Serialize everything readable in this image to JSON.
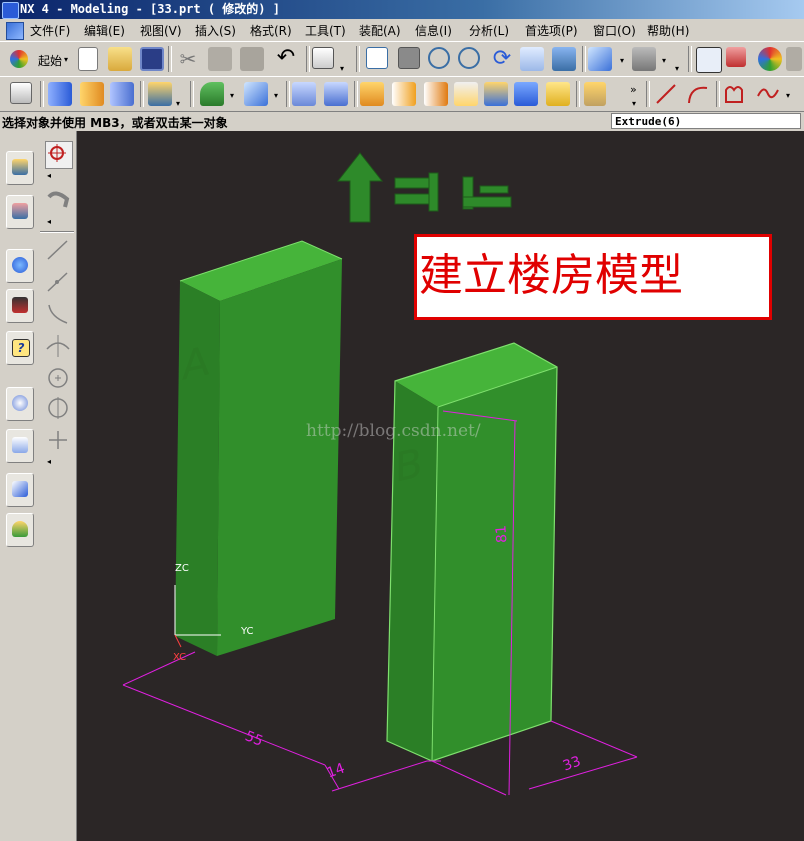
{
  "window": {
    "title": "NX 4 - Modeling - [33.prt ( 修改的) ]"
  },
  "menu": [
    {
      "label": "文件(F)"
    },
    {
      "label": "编辑(E)"
    },
    {
      "label": "视图(V)"
    },
    {
      "label": "插入(S)"
    },
    {
      "label": "格式(R)"
    },
    {
      "label": "工具(T)"
    },
    {
      "label": "装配(A)"
    },
    {
      "label": "信息(I)"
    },
    {
      "label": "分析(L)"
    },
    {
      "label": "首选项(P)"
    },
    {
      "label": "窗口(O)"
    },
    {
      "label": "帮助(H)"
    }
  ],
  "toolbar": {
    "start_label": "起始"
  },
  "status": {
    "prompt": "选择对象并使用 MB3，或者双击某一对象",
    "operation": "Extrude(6)"
  },
  "viewport": {
    "caption": "建立楼房模型",
    "watermark": "http://blog.csdn.net/",
    "building_a_label": "A",
    "building_b_label": "B",
    "wcs": {
      "z": "ZC",
      "y": "YC",
      "x": "XC"
    },
    "dimensions": {
      "width_a": "55",
      "gap": "14",
      "depth_b": "33",
      "height_b": "81"
    },
    "solid_color": "#2f8a2a",
    "selection_color": "#e020e0"
  }
}
